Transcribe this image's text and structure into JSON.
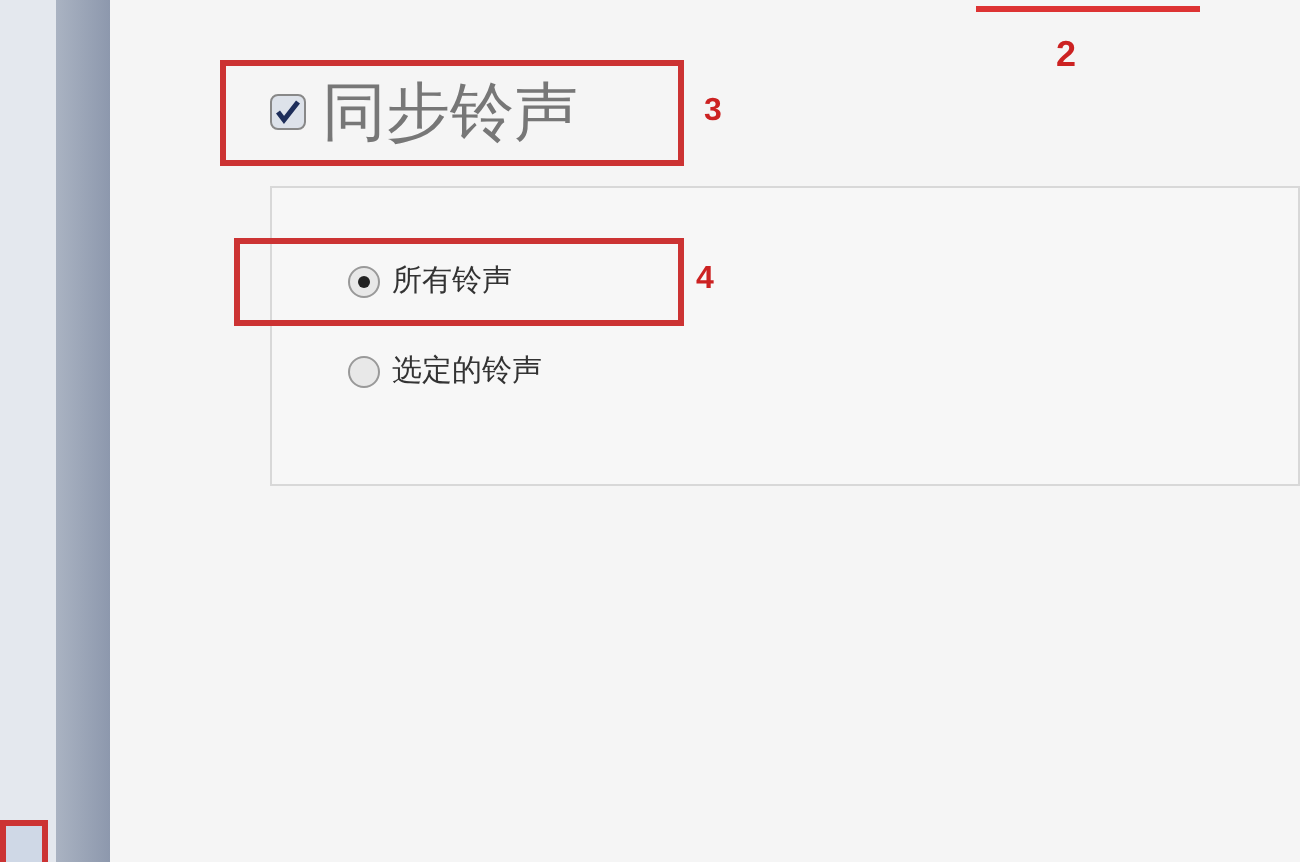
{
  "sync": {
    "label": "同步铃声",
    "checked": true
  },
  "options": [
    {
      "label": "所有铃声",
      "selected": true
    },
    {
      "label": "选定的铃声",
      "selected": false
    }
  ],
  "annotations": [
    "2",
    "3",
    "4"
  ]
}
